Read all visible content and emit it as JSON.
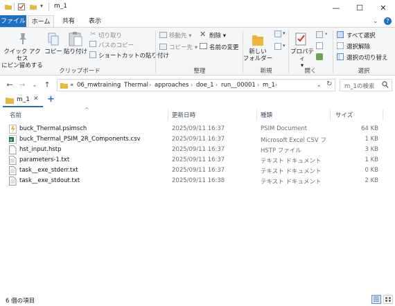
{
  "window": {
    "title": "m_1",
    "minimize_glyph": "—",
    "maximize_glyph": "☐",
    "close_glyph": "✕"
  },
  "ribbon_tabs": [
    "ファイル",
    "ホーム",
    "共有",
    "表示"
  ],
  "ribbon": {
    "clipboard": {
      "pin_label_1": "クイック アクセス",
      "pin_label_2": "にピン留めする",
      "copy": "コピー",
      "paste": "貼り付け",
      "cut": "切り取り",
      "copy_path": "パスのコピー",
      "paste_shortcut": "ショートカットの貼り付け",
      "group": "クリップボード"
    },
    "organize": {
      "move_to": "移動先",
      "copy_to": "コピー先",
      "delete": "削除",
      "rename": "名前の変更",
      "group": "整理"
    },
    "new": {
      "new_folder_1": "新しい",
      "new_folder_2": "フォルダー",
      "group": "新規"
    },
    "open": {
      "properties": "プロパティ",
      "group": "開く"
    },
    "select": {
      "select_all": "すべて選択",
      "select_none": "選択解除",
      "invert": "選択の切り替え",
      "group": "選択"
    }
  },
  "address": {
    "breadcrumbs": [
      "06_mwtraining",
      "Thermal",
      "approaches",
      "doe_1",
      "run__00001",
      "m_1"
    ],
    "overflow": "«",
    "search_placeholder": "m_1の検索"
  },
  "folder_tab": {
    "label": "m_1",
    "add": "+"
  },
  "columns": {
    "name": "名前",
    "date": "更新日時",
    "type": "種類",
    "size": "サイズ"
  },
  "files": [
    {
      "name": "buck_Thermal.psimsch",
      "date": "2025/09/11 16:37",
      "type": "PSIM Document",
      "size": "64 KB",
      "icon": "psim-icon"
    },
    {
      "name": "buck_Thermal_PSIM_2R_Components.csv",
      "date": "2025/09/11 16:37",
      "type": "Microsoft Excel CSV ファ...",
      "size": "1 KB",
      "icon": "excel-csv-icon"
    },
    {
      "name": "hst_input.hstp",
      "date": "2025/09/11 16:37",
      "type": "HSTP ファイル",
      "size": "3 KB",
      "icon": "file-icon"
    },
    {
      "name": "parameters-1.txt",
      "date": "2025/09/11 16:37",
      "type": "テキスト ドキュメント",
      "size": "1 KB",
      "icon": "text-file-icon"
    },
    {
      "name": "task__exe_stderr.txt",
      "date": "2025/09/11 16:37",
      "type": "テキスト ドキュメント",
      "size": "0 KB",
      "icon": "text-file-icon"
    },
    {
      "name": "task__exe_stdout.txt",
      "date": "2025/09/11 16:38",
      "type": "テキスト ドキュメント",
      "size": "2 KB",
      "icon": "text-file-icon"
    }
  ],
  "status": {
    "item_count": "6 個の項目"
  },
  "colors": {
    "accent": "#1e6fc2",
    "folder": "#e8b93a",
    "excel": "#1d7a44"
  }
}
